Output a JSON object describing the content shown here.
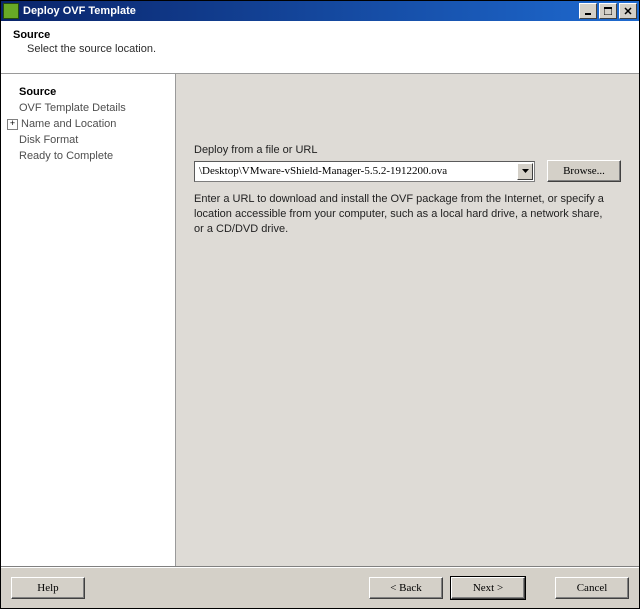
{
  "titlebar": {
    "title": "Deploy OVF Template"
  },
  "header": {
    "title": "Source",
    "subtitle": "Select the source location."
  },
  "sidebar": {
    "steps": [
      {
        "label": "Source"
      },
      {
        "label": "OVF Template Details"
      },
      {
        "label": "Name and Location"
      },
      {
        "label": "Disk Format"
      },
      {
        "label": "Ready to Complete"
      }
    ]
  },
  "main": {
    "prompt": "Deploy from a file or URL",
    "path_value": "\\Desktop\\VMware-vShield-Manager-5.5.2-1912200.ova",
    "browse": "Browse...",
    "hint": "Enter a URL to download and install the OVF package from the Internet, or specify a location accessible from your computer, such as a local hard drive, a network share, or a CD/DVD drive."
  },
  "footer": {
    "help": "Help",
    "back": "< Back",
    "next": "Next >",
    "cancel": "Cancel"
  }
}
